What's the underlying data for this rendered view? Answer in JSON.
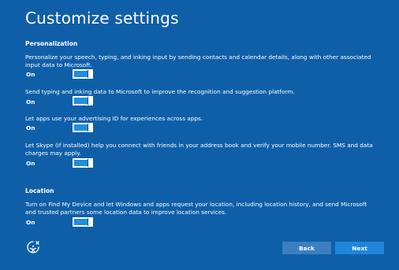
{
  "page": {
    "title": "Customize settings"
  },
  "personalization": {
    "heading": "Personalization",
    "items": [
      {
        "description": "Personalize your speech, typing, and inking input by sending contacts and calendar details, along with other associated input data to Microsoft.",
        "state": "On"
      },
      {
        "description": "Send typing and inking data to Microsoft to improve the recognition and suggestion platform.",
        "state": "On"
      },
      {
        "description": "Let apps use your advertising ID for experiences across apps.",
        "state": "On"
      },
      {
        "description": "Let Skype (if installed) help you connect with friends in your address book and verify your mobile number. SMS and data charges may apply.",
        "state": "On"
      }
    ]
  },
  "location": {
    "heading": "Location",
    "items": [
      {
        "description": "Turn on Find My Device and let Windows and apps request your location, including location history, and send Microsoft and trusted partners some location data to improve location services.",
        "state": "On"
      }
    ]
  },
  "footer": {
    "accessibility_icon": "ease-of-access-icon",
    "back_label": "Back",
    "next_label": "Next"
  },
  "colors": {
    "background": "#0f5fa8",
    "toggle_on": "#1f8fe0",
    "back_button": "#3a7fc1",
    "next_button": "#1f86dc"
  }
}
